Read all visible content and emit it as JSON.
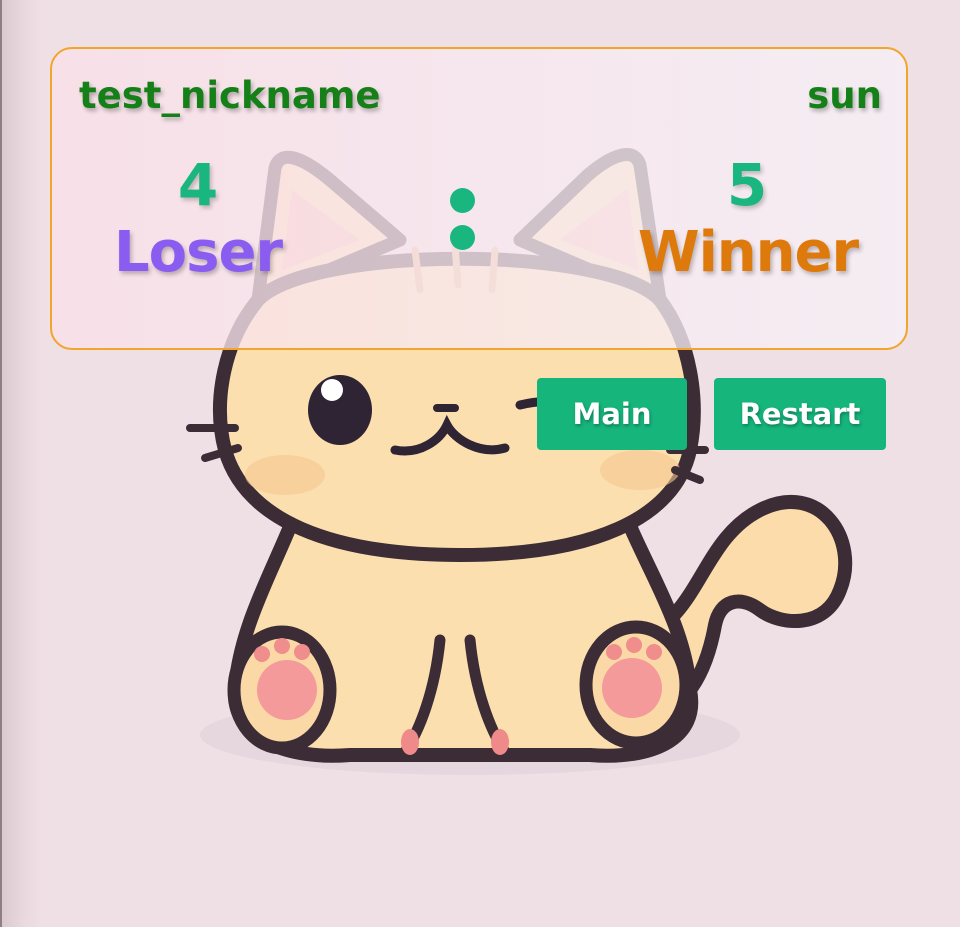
{
  "players": {
    "left": {
      "nickname": "test_nickname",
      "score": "4",
      "result": "Loser"
    },
    "right": {
      "nickname": "sun",
      "score": "5",
      "result": "Winner"
    }
  },
  "buttons": {
    "main": "Main",
    "restart": "Restart"
  },
  "colors": {
    "accent": "#16b57c",
    "nickname": "#168018",
    "loser": "#8b5cf0",
    "winner": "#dd7a0b",
    "board_border": "#f2a52a",
    "background": "#efe0e6"
  },
  "icons": {
    "background_art": "sitting-cat-illustration"
  }
}
